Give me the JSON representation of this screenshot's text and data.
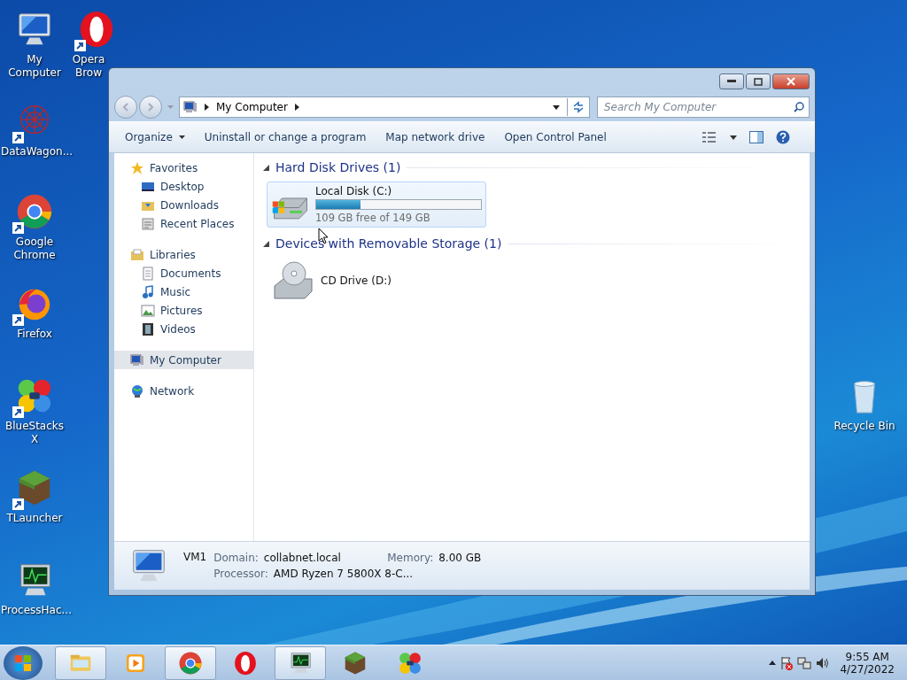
{
  "desktop_icons": [
    {
      "label": "My Computer",
      "kind": "computer",
      "shortcut": false
    },
    {
      "label": "Opera Brow",
      "kind": "opera",
      "shortcut": true
    },
    {
      "label": "DataWagon...",
      "kind": "datawagon",
      "shortcut": true
    },
    {
      "label": "Google Chrome",
      "kind": "chrome",
      "shortcut": true
    },
    {
      "label": "Firefox",
      "kind": "firefox",
      "shortcut": true
    },
    {
      "label": "BlueStacks X",
      "kind": "bluestacks",
      "shortcut": true
    },
    {
      "label": "TLauncher",
      "kind": "tlauncher",
      "shortcut": true
    },
    {
      "label": "ProcessHac...",
      "kind": "processhacker",
      "shortcut": false
    },
    {
      "label": "Recycle Bin",
      "kind": "recycle",
      "shortcut": false
    }
  ],
  "window": {
    "address": "My Computer",
    "search": {
      "placeholder": "Search My Computer"
    },
    "toolbar": [
      {
        "label": "Organize",
        "dropdown": true
      },
      {
        "label": "Uninstall or change a program",
        "dropdown": false
      },
      {
        "label": "Map network drive",
        "dropdown": false
      },
      {
        "label": "Open Control Panel",
        "dropdown": false
      }
    ],
    "nav": [
      {
        "label": "Favorites",
        "kind": "star",
        "selected": false,
        "children": [
          {
            "label": "Desktop",
            "kind": "desktop",
            "selected": false
          },
          {
            "label": "Downloads",
            "kind": "folder",
            "selected": false
          },
          {
            "label": "Recent Places",
            "kind": "recent",
            "selected": false
          }
        ]
      },
      {
        "label": "Libraries",
        "kind": "library",
        "selected": false,
        "children": [
          {
            "label": "Documents",
            "kind": "document",
            "selected": false
          },
          {
            "label": "Music",
            "kind": "music",
            "selected": false
          },
          {
            "label": "Pictures",
            "kind": "picture",
            "selected": false
          },
          {
            "label": "Videos",
            "kind": "video",
            "selected": false
          }
        ]
      },
      {
        "label": "My Computer",
        "kind": "computer",
        "selected": true
      },
      {
        "label": "Network",
        "kind": "network",
        "selected": false
      }
    ],
    "groups": [
      {
        "title": "Hard Disk Drives (1)",
        "expanded": true,
        "drives": [
          {
            "name": "Local Disk (C:)",
            "kind": "hdd",
            "selected": true,
            "level": 0.27,
            "free": "109 GB free of 149 GB"
          }
        ]
      },
      {
        "title": "Devices with Removable Storage (1)",
        "expanded": true,
        "drives": [
          {
            "name": "CD Drive (D:)",
            "kind": "cd",
            "selected": false
          }
        ]
      }
    ],
    "details": {
      "name": "VM1",
      "fields": [
        {
          "label": "Domain:",
          "value": "collabnet.local"
        },
        {
          "label": "Memory:",
          "value": "8.00 GB"
        },
        {
          "label": "Processor:",
          "value": "AMD Ryzen 7 5800X 8-C..."
        }
      ]
    }
  },
  "taskbar": {
    "items": [
      {
        "kind": "explorer",
        "active": true
      },
      {
        "kind": "media",
        "active": false
      },
      {
        "kind": "chrome",
        "active": true
      },
      {
        "kind": "opera",
        "active": false
      },
      {
        "kind": "processhacker",
        "active": true
      },
      {
        "kind": "tlauncher",
        "active": false
      },
      {
        "kind": "bluestacks",
        "active": false
      }
    ],
    "time": "9:55 AM",
    "date": "4/27/2022"
  }
}
